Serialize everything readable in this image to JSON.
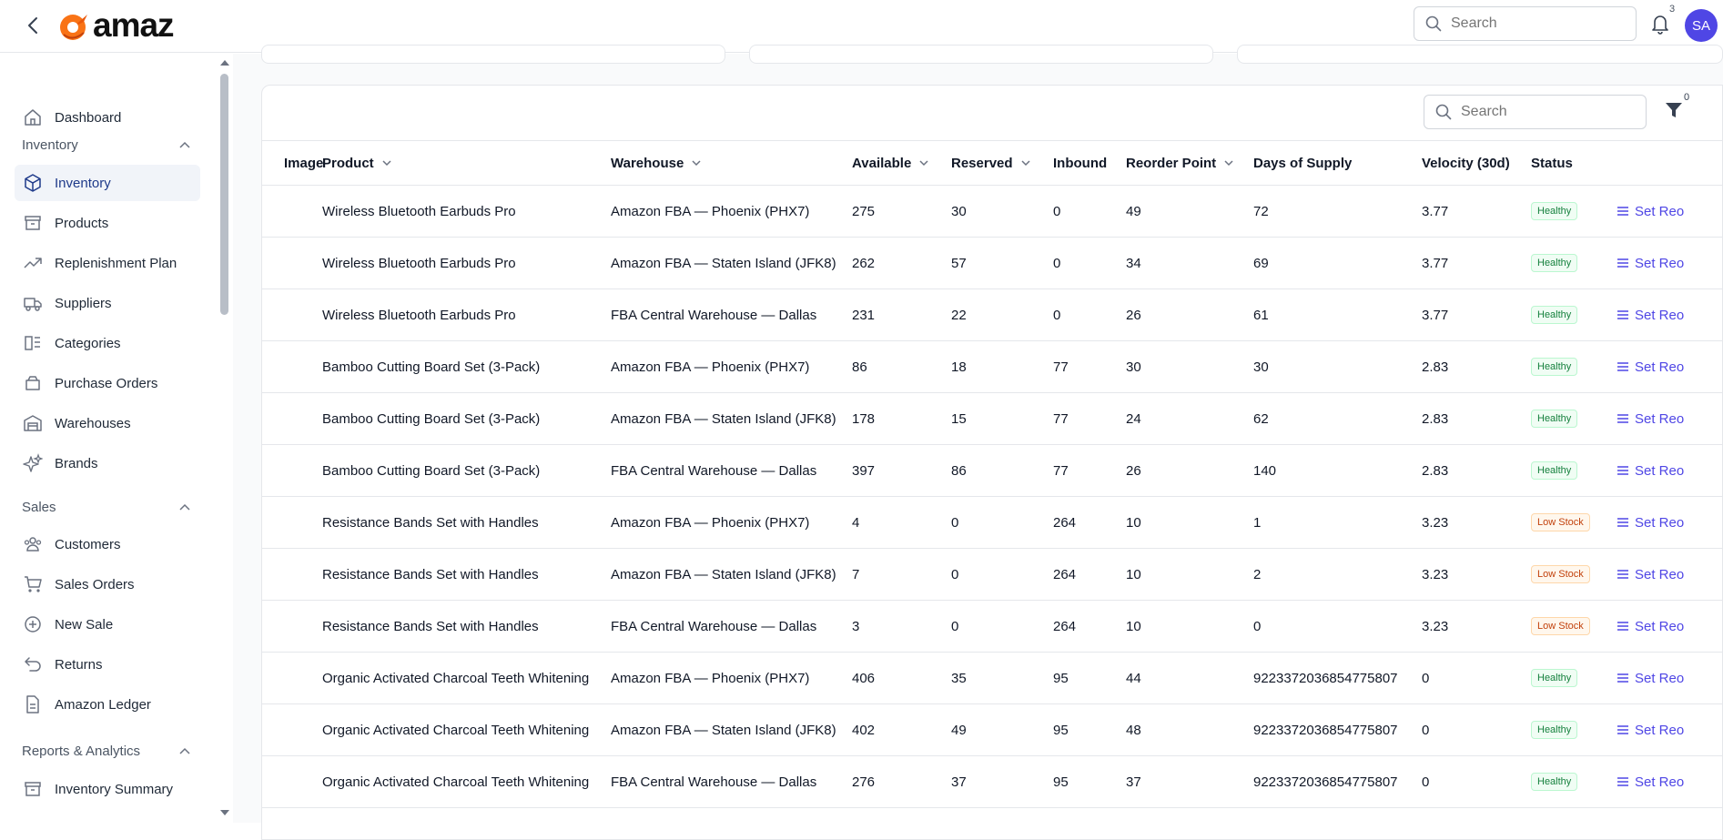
{
  "header": {
    "logo_text": "amaz",
    "search_placeholder": "Search",
    "notification_count": "3",
    "avatar_initials": "SA"
  },
  "sidebar": {
    "dashboard": "Dashboard",
    "sections": {
      "inventory": "Inventory",
      "sales": "Sales",
      "reports": "Reports & Analytics"
    },
    "items": {
      "inventory": "Inventory",
      "products": "Products",
      "replenishment": "Replenishment Plan",
      "suppliers": "Suppliers",
      "categories": "Categories",
      "purchase_orders": "Purchase Orders",
      "warehouses": "Warehouses",
      "brands": "Brands",
      "customers": "Customers",
      "sales_orders": "Sales Orders",
      "new_sale": "New Sale",
      "returns": "Returns",
      "amazon_ledger": "Amazon Ledger",
      "inventory_summary": "Inventory Summary"
    }
  },
  "table": {
    "search_placeholder": "Search",
    "filter_count": "0",
    "headers": {
      "image": "Image",
      "product": "Product",
      "warehouse": "Warehouse",
      "available": "Available",
      "reserved": "Reserved",
      "inbound": "Inbound",
      "reorder_point": "Reorder Point",
      "days_of_supply": "Days of Supply",
      "velocity": "Velocity (30d)",
      "status": "Status"
    },
    "action_label": "Set Reo",
    "rows": [
      {
        "product": "Wireless Bluetooth Earbuds Pro",
        "warehouse": "Amazon FBA — Phoenix (PHX7)",
        "available": "275",
        "reserved": "30",
        "inbound": "0",
        "reorder_point": "49",
        "days_of_supply": "72",
        "velocity": "3.77",
        "status": "Healthy",
        "status_type": "healthy"
      },
      {
        "product": "Wireless Bluetooth Earbuds Pro",
        "warehouse": "Amazon FBA — Staten Island (JFK8)",
        "available": "262",
        "reserved": "57",
        "inbound": "0",
        "reorder_point": "34",
        "days_of_supply": "69",
        "velocity": "3.77",
        "status": "Healthy",
        "status_type": "healthy"
      },
      {
        "product": "Wireless Bluetooth Earbuds Pro",
        "warehouse": "FBA Central Warehouse — Dallas",
        "available": "231",
        "reserved": "22",
        "inbound": "0",
        "reorder_point": "26",
        "days_of_supply": "61",
        "velocity": "3.77",
        "status": "Healthy",
        "status_type": "healthy"
      },
      {
        "product": "Bamboo Cutting Board Set (3-Pack)",
        "warehouse": "Amazon FBA — Phoenix (PHX7)",
        "available": "86",
        "reserved": "18",
        "inbound": "77",
        "reorder_point": "30",
        "days_of_supply": "30",
        "velocity": "2.83",
        "status": "Healthy",
        "status_type": "healthy"
      },
      {
        "product": "Bamboo Cutting Board Set (3-Pack)",
        "warehouse": "Amazon FBA — Staten Island (JFK8)",
        "available": "178",
        "reserved": "15",
        "inbound": "77",
        "reorder_point": "24",
        "days_of_supply": "62",
        "velocity": "2.83",
        "status": "Healthy",
        "status_type": "healthy"
      },
      {
        "product": "Bamboo Cutting Board Set (3-Pack)",
        "warehouse": "FBA Central Warehouse — Dallas",
        "available": "397",
        "reserved": "86",
        "inbound": "77",
        "reorder_point": "26",
        "days_of_supply": "140",
        "velocity": "2.83",
        "status": "Healthy",
        "status_type": "healthy"
      },
      {
        "product": "Resistance Bands Set with Handles",
        "warehouse": "Amazon FBA — Phoenix (PHX7)",
        "available": "4",
        "reserved": "0",
        "inbound": "264",
        "reorder_point": "10",
        "days_of_supply": "1",
        "velocity": "3.23",
        "status": "Low Stock",
        "status_type": "low"
      },
      {
        "product": "Resistance Bands Set with Handles",
        "warehouse": "Amazon FBA — Staten Island (JFK8)",
        "available": "7",
        "reserved": "0",
        "inbound": "264",
        "reorder_point": "10",
        "days_of_supply": "2",
        "velocity": "3.23",
        "status": "Low Stock",
        "status_type": "low"
      },
      {
        "product": "Resistance Bands Set with Handles",
        "warehouse": "FBA Central Warehouse — Dallas",
        "available": "3",
        "reserved": "0",
        "inbound": "264",
        "reorder_point": "10",
        "days_of_supply": "0",
        "velocity": "3.23",
        "status": "Low Stock",
        "status_type": "low"
      },
      {
        "product": "Organic Activated Charcoal Teeth Whitening",
        "warehouse": "Amazon FBA — Phoenix (PHX7)",
        "available": "406",
        "reserved": "35",
        "inbound": "95",
        "reorder_point": "44",
        "days_of_supply": "9223372036854775807",
        "velocity": "0",
        "status": "Healthy",
        "status_type": "healthy"
      },
      {
        "product": "Organic Activated Charcoal Teeth Whitening",
        "warehouse": "Amazon FBA — Staten Island (JFK8)",
        "available": "402",
        "reserved": "49",
        "inbound": "95",
        "reorder_point": "48",
        "days_of_supply": "9223372036854775807",
        "velocity": "0",
        "status": "Healthy",
        "status_type": "healthy"
      },
      {
        "product": "Organic Activated Charcoal Teeth Whitening",
        "warehouse": "FBA Central Warehouse — Dallas",
        "available": "276",
        "reserved": "37",
        "inbound": "95",
        "reorder_point": "37",
        "days_of_supply": "9223372036854775807",
        "velocity": "0",
        "status": "Healthy",
        "status_type": "healthy"
      }
    ]
  },
  "colors": {
    "accent": "#4f46e5",
    "healthy": "#15803d",
    "low_stock": "#c2410c"
  }
}
